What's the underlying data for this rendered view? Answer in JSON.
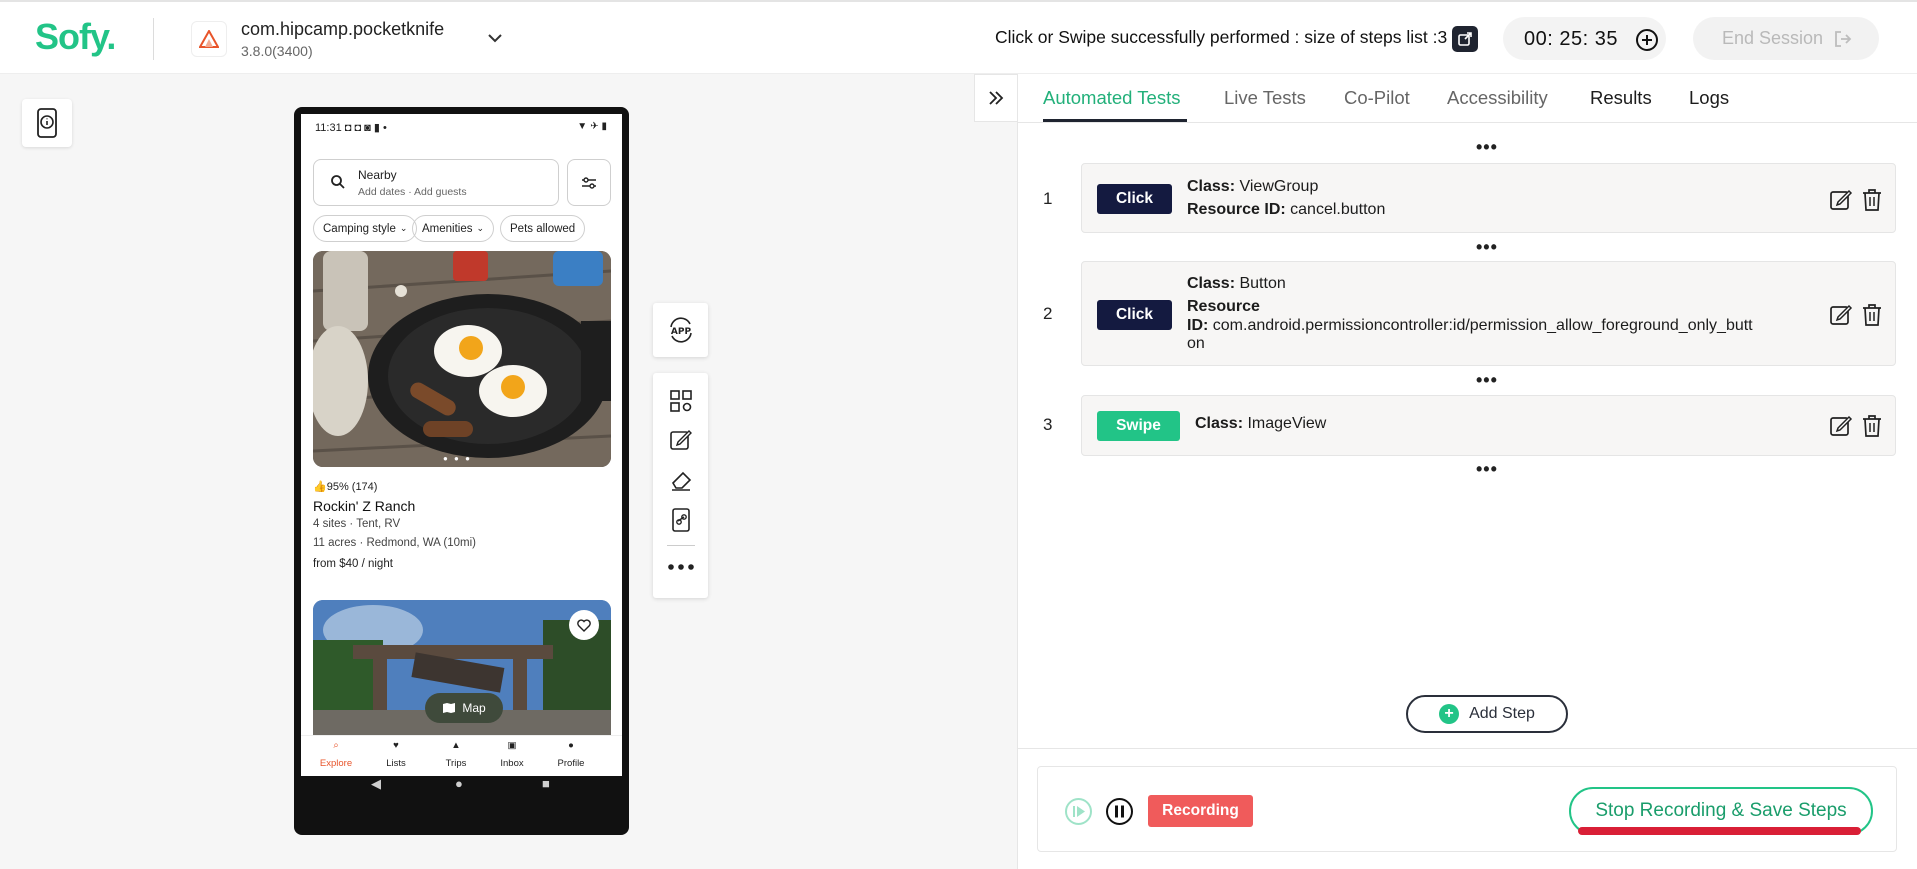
{
  "header": {
    "logo": "Sofy.",
    "app_name": "com.hipcamp.pocketknife",
    "app_version": "3.8.0(3400)",
    "status_message": "Click or Swipe successfully performed : size of steps list :3",
    "timer": "00: 25: 35",
    "end_session_label": "End Session"
  },
  "device": {
    "status_time": "11:31",
    "search_title": "Nearby",
    "search_subtitle": "Add dates · Add guests",
    "chips": [
      "Camping style",
      "Amenities",
      "Pets allowed"
    ],
    "rating": "95% (174)",
    "listing_title": "Rockin' Z Ranch",
    "listing_line1": "4 sites · Tent, RV",
    "listing_line2": "11 acres · Redmond, WA (10mi)",
    "listing_price": "from $40 / night",
    "map_label": "Map",
    "nav": [
      "Explore",
      "Lists",
      "Trips",
      "Inbox",
      "Profile"
    ],
    "nav_active": "Explore"
  },
  "tools": {
    "app_label": "APP"
  },
  "tabs": [
    {
      "label": "Automated Tests",
      "active": true
    },
    {
      "label": "Live Tests"
    },
    {
      "label": "Co-Pilot"
    },
    {
      "label": "Accessibility"
    },
    {
      "label": "Results"
    },
    {
      "label": "Logs"
    }
  ],
  "steps": [
    {
      "number": "1",
      "action": "Click",
      "class_label": "Class:",
      "class_value": "ViewGroup",
      "resource_label": "Resource ID:",
      "resource_value": "cancel.button"
    },
    {
      "number": "2",
      "action": "Click",
      "class_label": "Class:",
      "class_value": "Button",
      "resource_label_line1": "Resource",
      "resource_label_line2": "ID:",
      "resource_value_line1": "com.android.permissioncontroller:id/permission_allow_foreground_only_butt",
      "resource_value_line2": "on"
    },
    {
      "number": "3",
      "action": "Swipe",
      "class_label": "Class:",
      "class_value": "ImageView"
    }
  ],
  "ellipsis": "•••",
  "add_step_label": "Add Step",
  "recording": {
    "badge": "Recording",
    "stop_label": "Stop Recording & Save Steps"
  },
  "colors": {
    "brand_green": "#22c487",
    "click_badge": "#141a40",
    "recording_red": "#f05b5b",
    "underline_red": "#d91f36"
  }
}
